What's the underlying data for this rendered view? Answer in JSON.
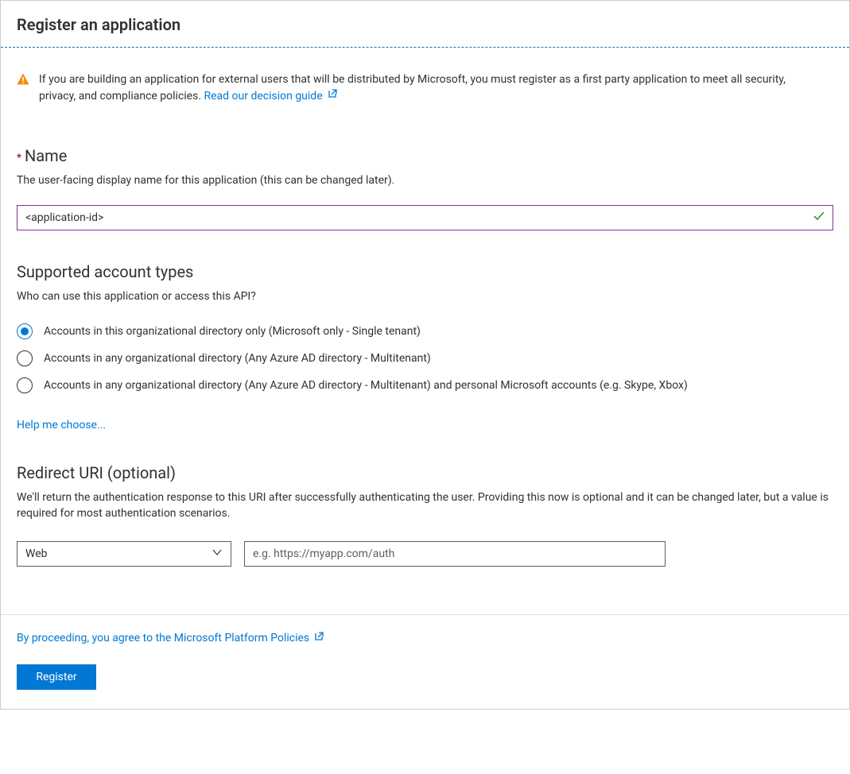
{
  "header": {
    "title": "Register an application"
  },
  "alert": {
    "text_before_link": "If you are building an application for external users that will be distributed by Microsoft, you must register as a first party application to meet all security, privacy, and compliance policies. ",
    "link_text": "Read our decision guide"
  },
  "name_section": {
    "label": "Name",
    "hint": "The user-facing display name for this application (this can be changed later).",
    "value": "<application-id>"
  },
  "account_types": {
    "heading": "Supported account types",
    "hint": "Who can use this application or access this API?",
    "options": [
      "Accounts in this organizational directory only (Microsoft only - Single tenant)",
      "Accounts in any organizational directory (Any Azure AD directory - Multitenant)",
      "Accounts in any organizational directory (Any Azure AD directory - Multitenant) and personal Microsoft accounts (e.g. Skype, Xbox)"
    ],
    "selected_index": 0,
    "help_link": "Help me choose..."
  },
  "redirect_uri": {
    "heading": "Redirect URI (optional)",
    "hint": "We'll return the authentication response to this URI after successfully authenticating the user. Providing this now is optional and it can be changed later, but a value is required for most authentication scenarios.",
    "dropdown_value": "Web",
    "placeholder": "e.g. https://myapp.com/auth"
  },
  "footer": {
    "policy_text": "By proceeding, you agree to the Microsoft Platform Policies",
    "register_label": "Register"
  }
}
